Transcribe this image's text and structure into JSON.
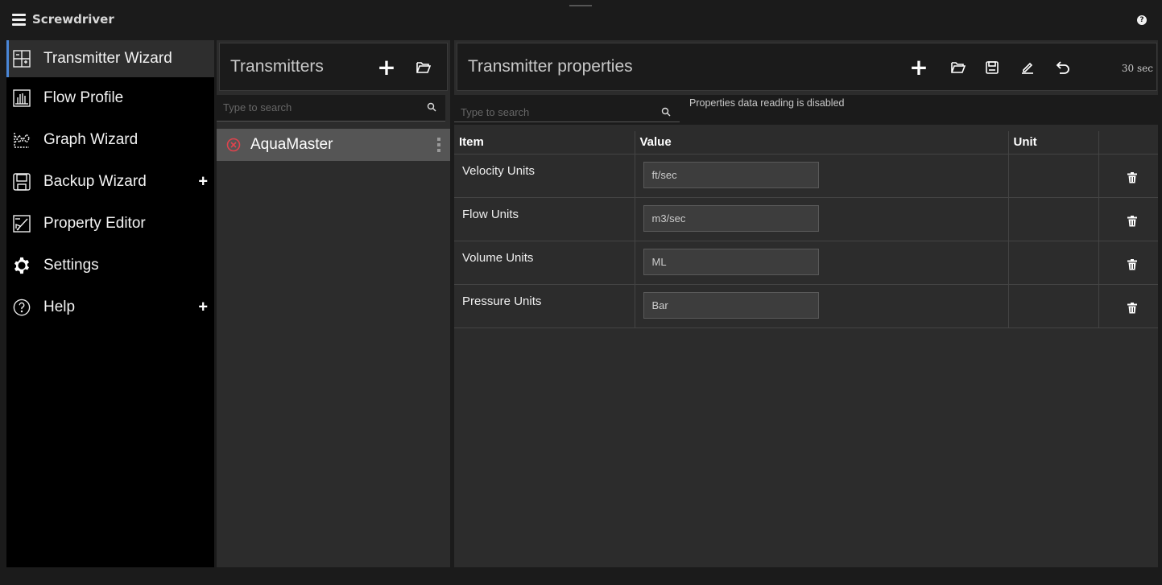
{
  "app": {
    "title": "Screwdriver"
  },
  "sidebar": {
    "items": [
      {
        "label": "Transmitter Wizard",
        "icon": "transmitter-wizard-icon",
        "active": true,
        "expandable": false
      },
      {
        "label": "Flow Profile",
        "icon": "flow-profile-icon",
        "active": false,
        "expandable": false
      },
      {
        "label": "Graph Wizard",
        "icon": "graph-wizard-icon",
        "active": false,
        "expandable": false
      },
      {
        "label": "Backup Wizard",
        "icon": "backup-wizard-icon",
        "active": false,
        "expandable": true
      },
      {
        "label": "Property Editor",
        "icon": "property-editor-icon",
        "active": false,
        "expandable": false
      },
      {
        "label": "Settings",
        "icon": "gear-icon",
        "active": false,
        "expandable": false
      },
      {
        "label": "Help",
        "icon": "help-circle-icon",
        "active": false,
        "expandable": true
      }
    ],
    "expand_symbol": "+"
  },
  "transmitters": {
    "title": "Transmitters",
    "search_placeholder": "Type to search",
    "items": [
      {
        "name": "AquaMaster",
        "status": "error"
      }
    ]
  },
  "properties": {
    "title": "Transmitter properties",
    "refresh_interval": "30 sec",
    "search_placeholder": "Type to search",
    "info": "Properties data reading is disabled",
    "columns": {
      "item": "Item",
      "value": "Value",
      "unit": "Unit"
    },
    "rows": [
      {
        "item": "Velocity Units",
        "value": "ft/sec",
        "unit": ""
      },
      {
        "item": "Flow Units",
        "value": "m3/sec",
        "unit": ""
      },
      {
        "item": "Volume Units",
        "value": "ML",
        "unit": ""
      },
      {
        "item": "Pressure Units",
        "value": "Bar",
        "unit": ""
      }
    ]
  },
  "colors": {
    "accent": "#4a86d6",
    "error": "#e0434d",
    "panel": "#2c2c2c",
    "background": "#1b1b1b"
  }
}
